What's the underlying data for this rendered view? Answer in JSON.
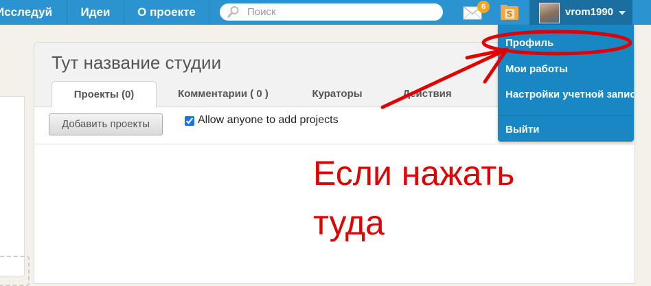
{
  "nav": {
    "explore": "Исследуй",
    "ideas": "Идеи",
    "about": "О проекте",
    "search_placeholder": "Поиск",
    "messages_count": "6",
    "username": "vrom1990"
  },
  "studio": {
    "title": "Тут название студии",
    "tabs": [
      {
        "label": "Проекты (0)",
        "active": true
      },
      {
        "label": "Комментарии ( 0 )",
        "active": false
      },
      {
        "label": "Кураторы",
        "active": false
      },
      {
        "label": "Действия",
        "active": false
      }
    ],
    "add_projects_button": "Добавить проекты",
    "allow_anyone_label": "Allow anyone to add projects",
    "allow_anyone_checked": true
  },
  "account_menu": {
    "items": [
      "Профиль",
      "Мои работы",
      "Настройки учетной записи"
    ],
    "logout": "Выйти"
  },
  "annotation": {
    "text_line1": "Если нажать",
    "text_line2": "туда",
    "color": "#e00000"
  },
  "colors": {
    "nav_bg": "#2b94d0",
    "dropdown_bg": "#1a87c5",
    "badge": "#f6a623"
  }
}
